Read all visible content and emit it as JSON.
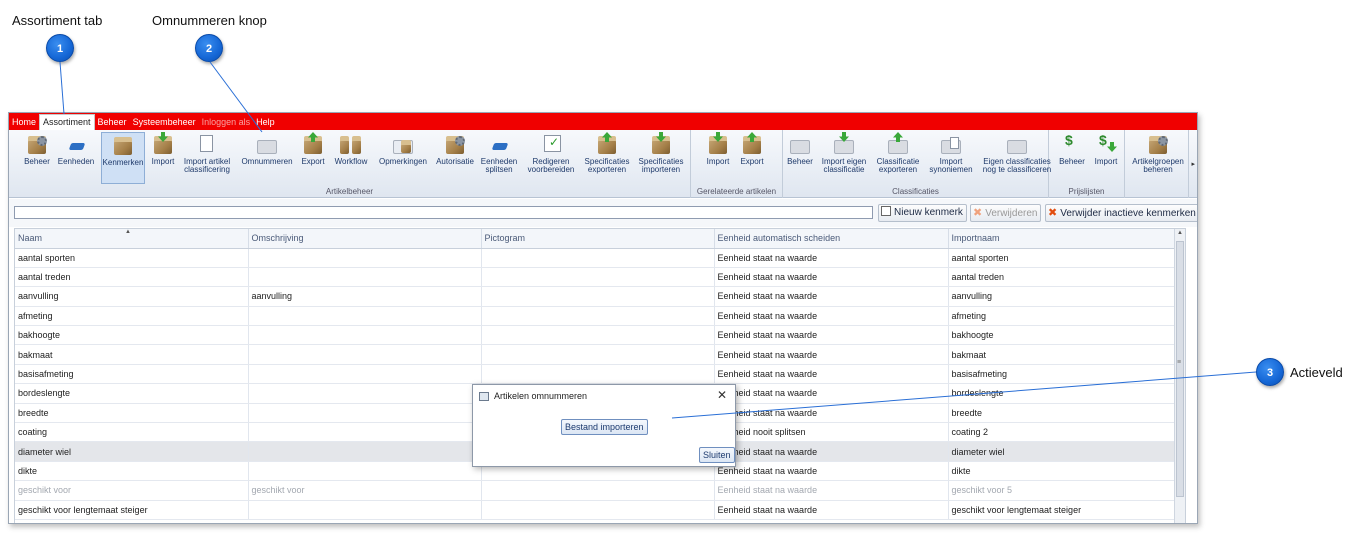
{
  "annotations": [
    {
      "number": "1",
      "label": "Assortiment tab"
    },
    {
      "number": "2",
      "label": "Omnummeren knop"
    },
    {
      "number": "3",
      "label": "Actieveld"
    }
  ],
  "menu": {
    "tabs": [
      "Home",
      "Assortiment",
      "Beheer",
      "Systeembeheer",
      "Inloggen als",
      "Help"
    ],
    "active": "Assortiment"
  },
  "ribbon": {
    "groups": [
      {
        "label": "Artikelbeheer",
        "buttons": [
          "Beheer",
          "Eenheden",
          "Kenmerken",
          "Import",
          "Import artikel classificering",
          "Omnummeren",
          "Export",
          "Workflow",
          "Opmerkingen",
          "Autorisatie",
          "Eenheden splitsen",
          "Redigeren voorbereiden",
          "Specificaties exporteren",
          "Specificaties importeren"
        ]
      },
      {
        "label": "Gerelateerde artikelen",
        "buttons": [
          "Import",
          "Export"
        ]
      },
      {
        "label": "Classificaties",
        "buttons": [
          "Beheer",
          "Import eigen classificatie",
          "Classificatie exporteren",
          "Import synoniemen",
          "Eigen classificaties nog te classificeren"
        ]
      },
      {
        "label": "Prijslijsten",
        "buttons": [
          "Beheer",
          "Import"
        ]
      },
      {
        "label": "",
        "buttons": [
          "Artikelgroepen beheren"
        ]
      }
    ],
    "selected": "Kenmerken"
  },
  "toolbar": {
    "search_value": "",
    "new_label": "Nieuw kenmerk",
    "delete_label": "Verwijderen",
    "delete_inactive_label": "Verwijder inactieve kenmerken"
  },
  "table": {
    "columns": [
      "Naam",
      "Omschrijving",
      "Pictogram",
      "Eenheid automatisch scheiden",
      "Importnaam"
    ],
    "rows": [
      [
        "aantal sporten",
        "",
        "",
        "Eenheid staat na waarde",
        "aantal sporten"
      ],
      [
        "aantal treden",
        "",
        "",
        "Eenheid staat na waarde",
        "aantal treden"
      ],
      [
        "aanvulling",
        "aanvulling",
        "",
        "Eenheid staat na waarde",
        "aanvulling"
      ],
      [
        "afmeting",
        "",
        "",
        "Eenheid staat na waarde",
        "afmeting"
      ],
      [
        "bakhoogte",
        "",
        "",
        "Eenheid staat na waarde",
        "bakhoogte"
      ],
      [
        "bakmaat",
        "",
        "",
        "Eenheid staat na waarde",
        "bakmaat"
      ],
      [
        "basisafmeting",
        "",
        "",
        "Eenheid staat na waarde",
        "basisafmeting"
      ],
      [
        "bordeslengte",
        "",
        "",
        "Eenheid staat na waarde",
        "bordeslengte"
      ],
      [
        "breedte",
        "",
        "",
        "Eenheid staat na waarde",
        "breedte"
      ],
      [
        "coating",
        "",
        "",
        "Eenheid nooit splitsen",
        "coating 2"
      ],
      [
        "diameter wiel",
        "",
        "",
        "Eenheid staat na waarde",
        "diameter wiel"
      ],
      [
        "dikte",
        "",
        "",
        "Eenheid staat na waarde",
        "dikte"
      ],
      [
        "geschikt voor",
        "geschikt voor",
        "",
        "Eenheid staat na waarde",
        "geschikt voor 5"
      ],
      [
        "geschikt voor lengtemaat steiger",
        "",
        "",
        "Eenheid staat na waarde",
        "geschikt voor lengtemaat steiger"
      ]
    ],
    "selected_row": 10,
    "inactive_row": 12
  },
  "dialog": {
    "title": "Artikelen omnummeren",
    "import_label": "Bestand importeren",
    "close_label": "Sluiten"
  }
}
